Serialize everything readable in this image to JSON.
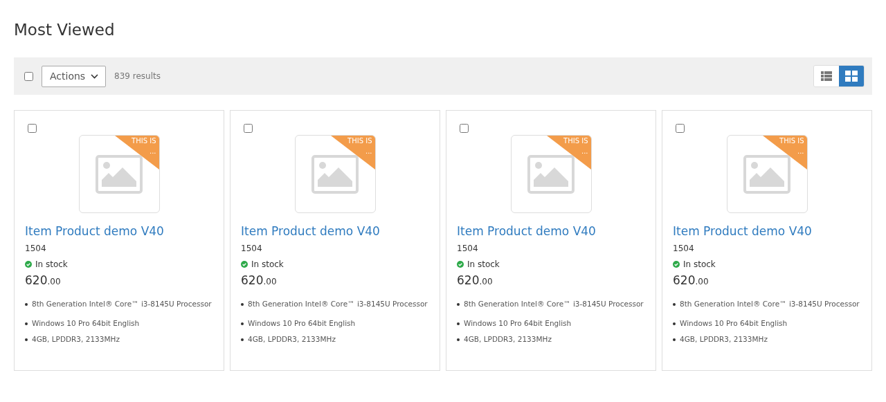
{
  "title": "Most Viewed",
  "toolbar": {
    "select_all_checked": false,
    "actions": "Actions",
    "results": "839 results",
    "views": [
      {
        "kind": "list",
        "selected": false
      },
      {
        "kind": "grid",
        "selected": true
      }
    ]
  },
  "products": [
    {
      "checked": false,
      "ribbon": [
        "THIS IS",
        "..."
      ],
      "name": "Item Product demo V40",
      "sku": "1504",
      "stock": "In stock",
      "price": "620",
      "price_decimals": ".00",
      "features": [
        "8th Generation Intel® Core™ i3-8145U Processor",
        "Windows 10 Pro 64bit English",
        "4GB, LPDDR3, 2133MHz"
      ]
    },
    {
      "checked": false,
      "ribbon": [
        "THIS IS",
        "..."
      ],
      "name": "Item Product demo V40",
      "sku": "1504",
      "stock": "In stock",
      "price": "620",
      "price_decimals": ".00",
      "features": [
        "8th Generation Intel® Core™ i3-8145U Processor",
        "Windows 10 Pro 64bit English",
        "4GB, LPDDR3, 2133MHz"
      ]
    },
    {
      "checked": false,
      "ribbon": [
        "THIS IS",
        "..."
      ],
      "name": "Item Product demo V40",
      "sku": "1504",
      "stock": "In stock",
      "price": "620",
      "price_decimals": ".00",
      "features": [
        "8th Generation Intel® Core™ i3-8145U Processor",
        "Windows 10 Pro 64bit English",
        "4GB, LPDDR3, 2133MHz"
      ]
    },
    {
      "checked": false,
      "ribbon": [
        "THIS IS",
        "..."
      ],
      "name": "Item Product demo V40",
      "sku": "1504",
      "stock": "In stock",
      "price": "620",
      "price_decimals": ".00",
      "features": [
        "8th Generation Intel® Core™ i3-8145U Processor",
        "Windows 10 Pro 64bit English",
        "4GB, LPDDR3, 2133MHz"
      ]
    }
  ]
}
